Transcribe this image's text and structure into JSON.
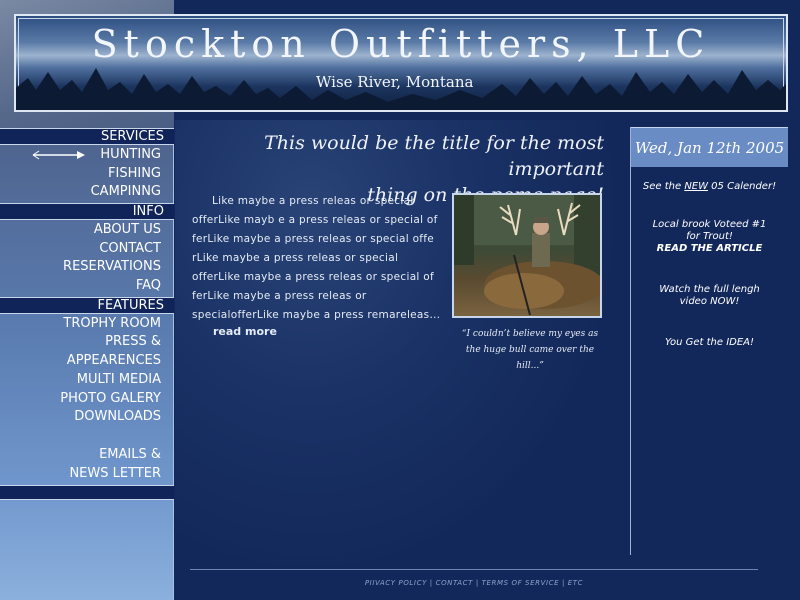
{
  "header": {
    "title": "Stockton Outfitters, LLC",
    "subtitle": "Wise River, Montana"
  },
  "sidebar": {
    "sections": [
      {
        "heading": "SERVICES",
        "items": [
          {
            "label": "HUNTING",
            "active": true
          },
          {
            "label": "FISHING"
          },
          {
            "label": "CAMPINNG"
          }
        ]
      },
      {
        "heading": "INFO",
        "items": [
          {
            "label": "ABOUT US"
          },
          {
            "label": "CONTACT"
          },
          {
            "label": "RESERVATIONS"
          },
          {
            "label": "FAQ"
          }
        ]
      },
      {
        "heading": "FEATURES",
        "items": [
          {
            "label": "TROPHY ROOM"
          },
          {
            "label": "PRESS &"
          },
          {
            "label": "APPEARENCES"
          },
          {
            "label": "MULTI MEDIA"
          },
          {
            "label": "PHOTO GALERY"
          },
          {
            "label": "DOWNLOADS"
          },
          {
            "label": "EMAILS &"
          },
          {
            "label": "NEWS LETTER"
          }
        ]
      }
    ],
    "active_icon": "arrow-icon"
  },
  "main": {
    "headline_line1": "This would be the title for the most important",
    "headline_line2": "thing on the pome page!",
    "intro": "Like maybe a press releas or special offerLike mayb e  a press releas or special of ferLike maybe a press releas or special offe rLike maybe a press releas or special offerLike maybe a press releas or special of ferLike maybe a press releas or specialofferLike maybe a press remareleas...",
    "read_more": "read more",
    "photo_icon": "elk-hunter-photo",
    "caption": "“I couldn’t believe my eyes as the  huge bull came over the hill...”"
  },
  "right": {
    "date": "Wed, Jan 12th 2005",
    "link1_pre": "See the ",
    "link1_new": "NEW",
    "link1_post": " 05 Calender!",
    "link2_line1": "Local brook Voteed #1",
    "link2_line2": "for Trout!",
    "link2_line3": "READ THE ARTICLE",
    "link3_line1": "Watch the full lengh",
    "link3_line2": "video NOW!",
    "link4": "You Get the IDEA!"
  },
  "footer": {
    "privacy": "PIIVACY POLICY",
    "contact": "CONTACT",
    "terms": "TERMS OF SERVICE",
    "etc": "ETC",
    "separator": " | "
  },
  "colors": {
    "background": "#13285a",
    "sidebar_heading": "#10245a",
    "date_box": "#6a8cc4"
  }
}
